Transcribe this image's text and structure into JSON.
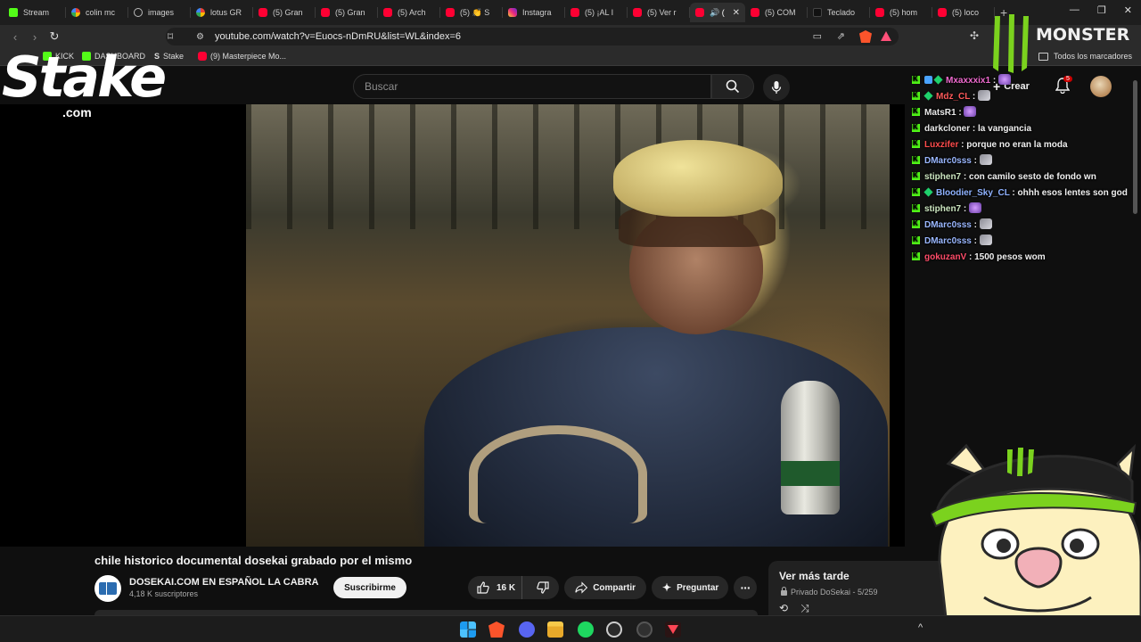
{
  "browser": {
    "tabs": [
      {
        "label": "Stream",
        "icon": "kick-icon"
      },
      {
        "label": "colin mc",
        "icon": "google-icon"
      },
      {
        "label": "images",
        "icon": "globe-icon"
      },
      {
        "label": "lotus GR",
        "icon": "google-icon"
      },
      {
        "label": "(5) Gran",
        "icon": "youtube-icon"
      },
      {
        "label": "(5) Gran",
        "icon": "youtube-icon"
      },
      {
        "label": "(5) Arch",
        "icon": "youtube-icon"
      },
      {
        "label": "(5) 👏 S",
        "icon": "youtube-icon"
      },
      {
        "label": "Instagra",
        "icon": "instagram-icon"
      },
      {
        "label": "(5) ¡AL I",
        "icon": "youtube-icon"
      },
      {
        "label": "(5) Ver r",
        "icon": "youtube-icon"
      },
      {
        "label": "🔊 (",
        "icon": "youtube-icon",
        "active": true
      },
      {
        "label": "(5) COM",
        "icon": "youtube-icon"
      },
      {
        "label": "Teclado",
        "icon": "dark-icon"
      },
      {
        "label": "(5) hom",
        "icon": "youtube-icon"
      },
      {
        "label": "(5) loco",
        "icon": "youtube-icon"
      }
    ],
    "new_tab": "+",
    "window_controls": [
      "—",
      "❐",
      "✕"
    ],
    "url": "youtube.com/watch?v=Euocs-nDmRU&list=WL&index=6",
    "bookmarks": [
      {
        "label": "KICK",
        "icon": "kick-icon"
      },
      {
        "label": "DASHBOARD",
        "icon": "kick-icon"
      },
      {
        "label": "Stake",
        "icon": "stake-icon"
      },
      {
        "label": "(9) Masterpiece Mo...",
        "icon": "youtube-icon"
      }
    ],
    "all_bookmarks": "Todos los marcadores"
  },
  "youtube": {
    "search_placeholder": "Buscar",
    "create_label": "Crear",
    "notification_count": "5",
    "video_title": "chile historico documental dosekai grabado por el mismo",
    "channel_name": "DOSEKAI.COM EN ESPAÑOL LA CABRA",
    "subscribers": "4,18 K suscriptores",
    "subscribe_label": "Suscribirme",
    "likes": "16 K",
    "share_label": "Compartir",
    "ask_label": "Preguntar",
    "playlist": {
      "title": "Ver más tarde",
      "meta": "Privado DoSekai - 5/259"
    }
  },
  "overlays": {
    "stake_logo": "Stake",
    "stake_logo_sub": ".com",
    "monster_logo": "MONSTER"
  },
  "chat": [
    {
      "user": "Mxaxxxix1",
      "color": "#f06bd0",
      "badges": [
        "kick",
        "alt",
        "sub"
      ],
      "text": "",
      "emote": "purple"
    },
    {
      "user": "Mdz_CL",
      "color": "#ff5a5a",
      "badges": [
        "kick",
        "sub"
      ],
      "text": "",
      "emote": "grey"
    },
    {
      "user": "MatsR1",
      "color": "#e8e8e8",
      "badges": [
        "kick"
      ],
      "text": "",
      "emote": "purple"
    },
    {
      "user": "darkcloner",
      "color": "#e8e8e8",
      "badges": [
        "kick"
      ],
      "text": "la vangancia",
      "emote": ""
    },
    {
      "user": "Luxzifer",
      "color": "#ff4d4d",
      "badges": [
        "kick"
      ],
      "text": "porque no eran la moda",
      "emote": ""
    },
    {
      "user": "DMarc0sss",
      "color": "#9ab7ff",
      "badges": [
        "kick"
      ],
      "text": "",
      "emote": "grey"
    },
    {
      "user": "stiphen7",
      "color": "#cde7c1",
      "badges": [
        "kick"
      ],
      "text": "con camilo sesto de fondo wn",
      "emote": ""
    },
    {
      "user": "Bloodier_Sky_CL",
      "color": "#8fb2ff",
      "badges": [
        "kick",
        "sub"
      ],
      "text": "ohhh esos lentes son god",
      "emote": ""
    },
    {
      "user": "stiphen7",
      "color": "#cde7c1",
      "badges": [
        "kick"
      ],
      "text": "",
      "emote": "purple"
    },
    {
      "user": "DMarc0sss",
      "color": "#9ab7ff",
      "badges": [
        "kick"
      ],
      "text": "",
      "emote": "grey"
    },
    {
      "user": "DMarc0sss",
      "color": "#9ab7ff",
      "badges": [
        "kick"
      ],
      "text": "",
      "emote": "grey"
    },
    {
      "user": "gokuzanV",
      "color": "#ff4d6a",
      "badges": [
        "kick"
      ],
      "text": "1500 pesos wom",
      "emote": ""
    }
  ],
  "taskbar": {
    "apps": [
      "windows-start",
      "brave",
      "discord",
      "file-explorer",
      "spotify",
      "chatgpt",
      "obs",
      "valorant"
    ],
    "tray_chevron": "^"
  }
}
